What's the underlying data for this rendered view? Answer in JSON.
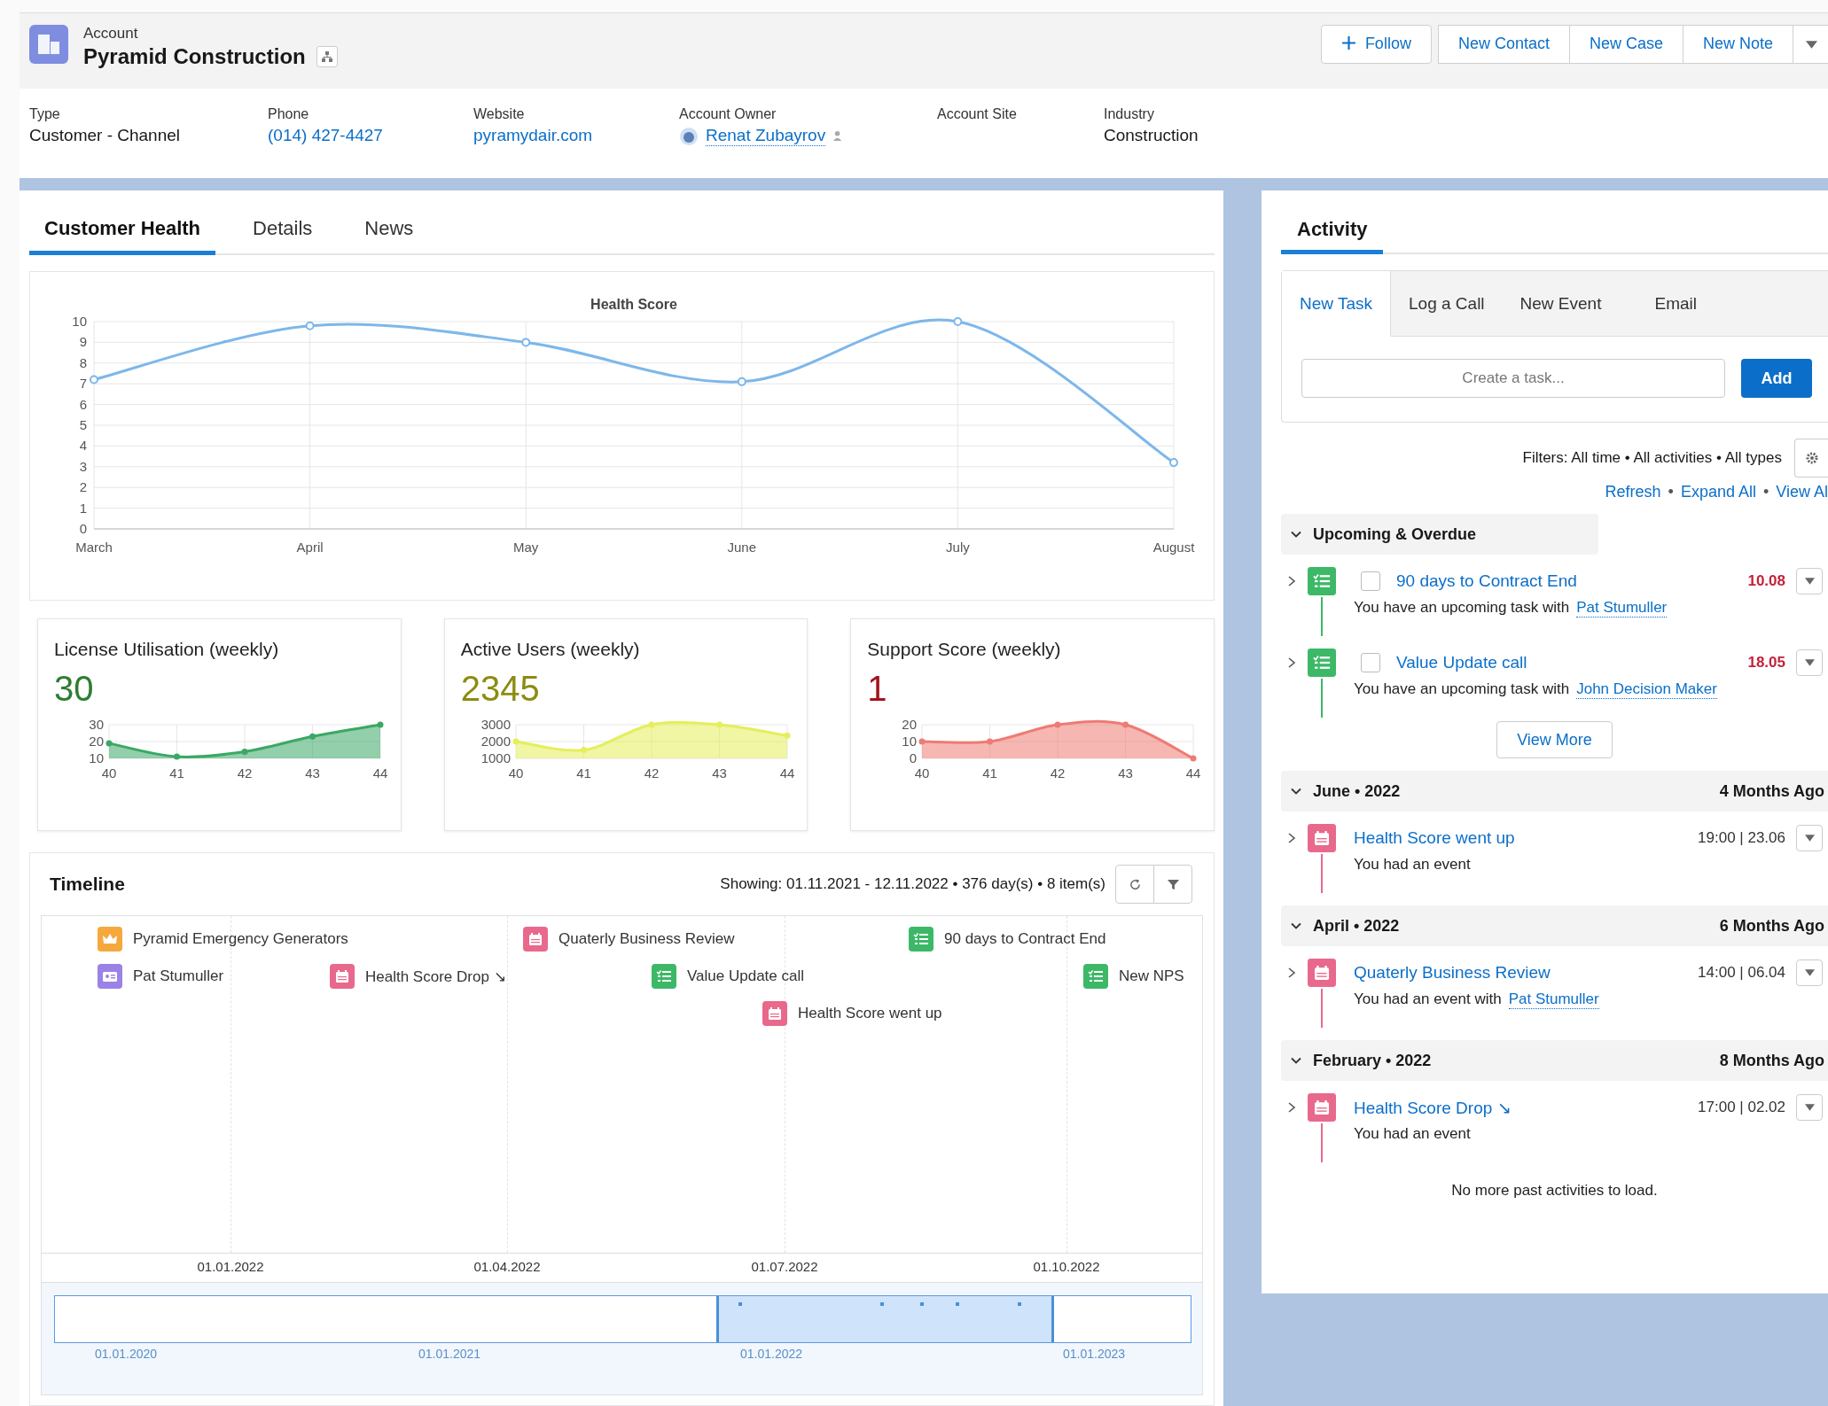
{
  "header": {
    "object_type": "Account",
    "title": "Pyramid Construction",
    "actions": [
      {
        "label": "Follow",
        "kind": "follow"
      },
      {
        "label": "New Contact",
        "kind": "group"
      },
      {
        "label": "New Case",
        "kind": "group"
      },
      {
        "label": "New Note",
        "kind": "group"
      }
    ]
  },
  "fields": [
    {
      "label": "Type",
      "value": "Customer - Channel",
      "kind": "text"
    },
    {
      "label": "Phone",
      "value": "(014) 427-4427",
      "kind": "link"
    },
    {
      "label": "Website",
      "value": "pyramydair.com",
      "kind": "link"
    },
    {
      "label": "Account Owner",
      "value": "Renat Zubayrov",
      "kind": "user"
    },
    {
      "label": "Account Site"
    },
    {
      "label": "Industry",
      "value": "Construction",
      "kind": "text"
    }
  ],
  "tabs": [
    {
      "label": "Customer Health",
      "selected": true
    },
    {
      "label": "Details",
      "selected": false
    },
    {
      "label": "News",
      "selected": false
    }
  ],
  "health_chart": {
    "chart_data": {
      "type": "line",
      "title": "Health Score",
      "categories": [
        "March",
        "April",
        "May",
        "June",
        "July",
        "August"
      ],
      "series": [
        {
          "color": "#7db7ea",
          "marker": true,
          "values": [
            7.2,
            9.8,
            9,
            7.1,
            10,
            3.2
          ]
        }
      ],
      "grid": true,
      "ylim": [
        0,
        10
      ],
      "yticks": [
        0,
        1,
        2,
        3,
        4,
        5,
        6,
        7,
        8,
        9,
        10
      ]
    }
  },
  "kpis": [
    {
      "title": "License Utilisation (weekly)",
      "value": "30",
      "color": "#2e7d32",
      "chart_data": {
        "type": "area",
        "categories": [
          "40",
          "41",
          "42",
          "43",
          "44"
        ],
        "series": [
          {
            "color": "#3aa865",
            "marker": true,
            "values": [
              19,
              11,
              14,
              23,
              30
            ]
          }
        ],
        "grid": true,
        "ylim": [
          10,
          30
        ],
        "yticks": [
          10,
          20,
          30
        ]
      }
    },
    {
      "title": "Active Users (weekly)",
      "value": "2345",
      "color": "#8c8c10",
      "chart_data": {
        "type": "area",
        "categories": [
          "40",
          "41",
          "42",
          "43",
          "44"
        ],
        "series": [
          {
            "color": "#e4ef5a",
            "marker": true,
            "values": [
              2000,
              1500,
              3000,
              3000,
              2350
            ]
          }
        ],
        "grid": true,
        "ylim": [
          1000,
          3000
        ],
        "yticks": [
          1000,
          2000,
          3000
        ]
      }
    },
    {
      "title": "Support Score (weekly)",
      "value": "1",
      "color": "#a3131a",
      "chart_data": {
        "type": "area",
        "categories": [
          "40",
          "41",
          "42",
          "43",
          "44"
        ],
        "series": [
          {
            "color": "#ee7b74",
            "marker": true,
            "values": [
              10,
              10,
              20,
              20,
              0
            ]
          }
        ],
        "grid": true,
        "ylim": [
          0,
          20
        ],
        "yticks": [
          0,
          10,
          20
        ]
      }
    }
  ],
  "timeline": {
    "title": "Timeline",
    "showing": "Showing: 01.11.2021 - 12.11.2022 • 376 day(s) • 8 item(s)",
    "items": [
      {
        "kind": "account",
        "label": "Pyramid Emergency Generators"
      },
      {
        "kind": "event",
        "label": "Quaterly Business Review"
      },
      {
        "kind": "task",
        "label": "90 days to Contract End"
      },
      {
        "kind": "contact",
        "label": "Pat Stumuller"
      },
      {
        "kind": "event",
        "label": "Health Score Drop ↘"
      },
      {
        "kind": "task",
        "label": "Value Update call"
      },
      {
        "kind": "task",
        "label": "New NPS"
      },
      {
        "kind": "event",
        "label": "Health Score went up"
      }
    ],
    "axis_labels": [
      "01.01.2022",
      "01.04.2022",
      "01.07.2022",
      "01.10.2022"
    ],
    "navigator_labels": [
      "01.01.2020",
      "01.01.2021",
      "01.01.2022",
      "01.01.2023"
    ]
  },
  "activity": {
    "title": "Activity",
    "tabs": [
      {
        "label": "New Task",
        "selected": true
      },
      {
        "label": "Log a Call",
        "selected": false
      },
      {
        "label": "New Event",
        "selected": false
      },
      {
        "label": "Email",
        "selected": false
      }
    ],
    "task_input": {
      "placeholder": "Create a task..."
    },
    "add_button": "Add",
    "filters": "Filters: All time • All activities • All types",
    "links": [
      "Refresh",
      "Expand All",
      "View Al"
    ],
    "link_separator": "•",
    "sections": [
      {
        "title": "Upcoming & Overdue",
        "expanded": true,
        "items": [
          {
            "kind": "task",
            "checked": false,
            "expanded": false,
            "title": "90 days to Contract End",
            "date": "10.08",
            "description": "You have an upcoming task with",
            "person": "Pat Stumuller"
          },
          {
            "kind": "task",
            "checked": false,
            "expanded": false,
            "title": "Value Update call",
            "date": "18.05",
            "description": "You have an upcoming task with",
            "person": "John Decision Maker"
          }
        ],
        "more_button": "View More"
      },
      {
        "title": "June • 2022",
        "ago": "4 Months Ago",
        "expanded": true,
        "items": [
          {
            "kind": "event",
            "expanded": false,
            "title": "Health Score went up",
            "date": "19:00 | 23.06",
            "description": "You had an event"
          }
        ]
      },
      {
        "title": "April • 2022",
        "ago": "6 Months Ago",
        "expanded": true,
        "items": [
          {
            "kind": "event",
            "expanded": false,
            "title": "Quaterly Business Review",
            "date": "14:00 | 06.04",
            "description": "You had an event with",
            "person": "Pat Stumuller"
          }
        ]
      },
      {
        "title": "February • 2022",
        "ago": "8 Months Ago",
        "expanded": true,
        "items": [
          {
            "kind": "event",
            "expanded": false,
            "title": "Health Score Drop ↘",
            "date": "17:00 | 02.02",
            "description": "You had an event"
          }
        ]
      }
    ],
    "footer": "No more past activities to load."
  }
}
